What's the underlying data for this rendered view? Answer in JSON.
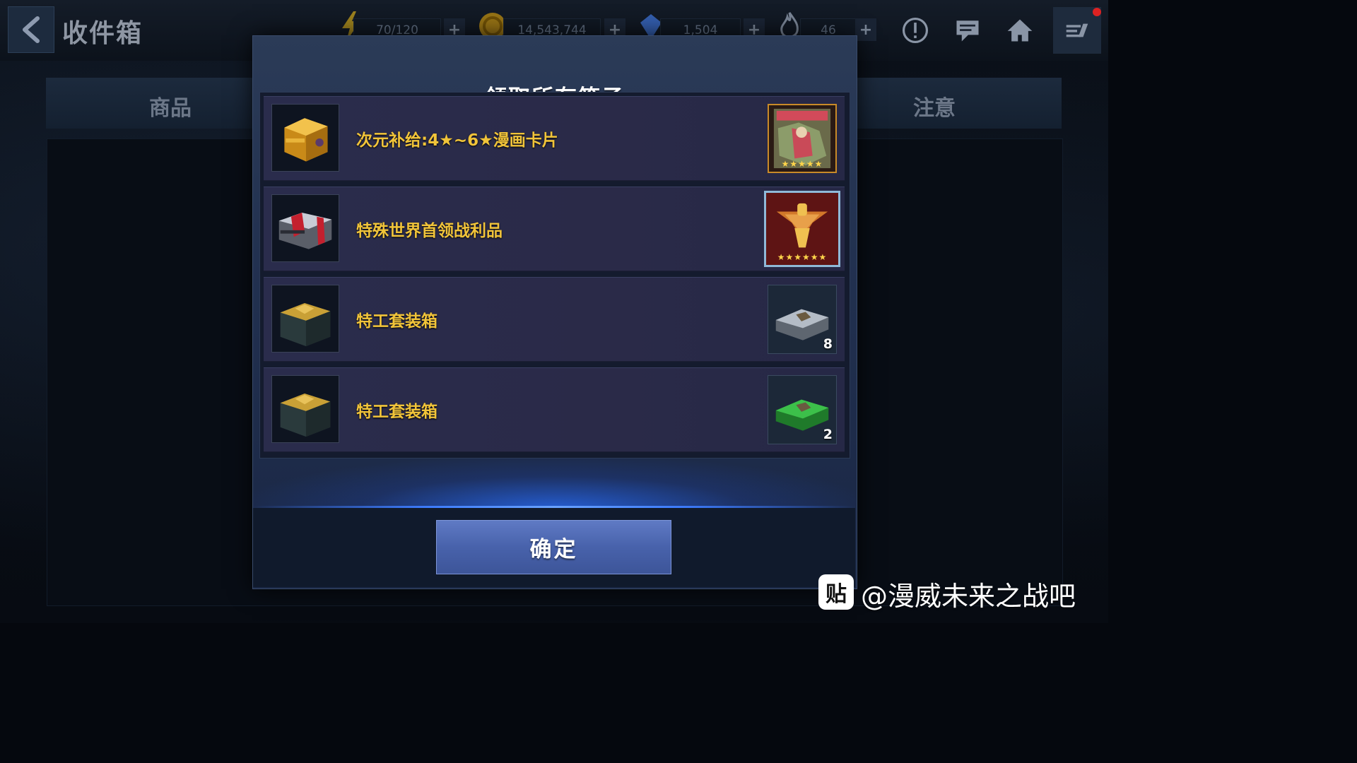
{
  "header": {
    "title": "收件箱",
    "resources": [
      {
        "name": "energy",
        "value": "70/120",
        "icon": "lightning-icon"
      },
      {
        "name": "gold",
        "value": "14,543,744",
        "icon": "gold-coin-icon"
      },
      {
        "name": "crystal",
        "value": "1,504",
        "icon": "crystal-icon"
      },
      {
        "name": "stamina",
        "value": "46",
        "icon": "flame-icon"
      }
    ],
    "add_label": "+"
  },
  "tabs": [
    {
      "label": "商品"
    },
    {
      "label": "注意"
    }
  ],
  "dialog": {
    "title": "领取所有箱子",
    "items": [
      {
        "label": "次元补给:4★~6★漫画卡片",
        "reward": "comic-card",
        "count": "",
        "stars": "★★★★★"
      },
      {
        "label": "特殊世界首领战利品",
        "reward": "boss-emblem",
        "count": "",
        "stars": "★★★★★★"
      },
      {
        "label": "特工套装箱",
        "reward": "silver-gear-box",
        "count": "8",
        "stars": ""
      },
      {
        "label": "特工套装箱",
        "reward": "green-gear-box",
        "count": "2",
        "stars": ""
      }
    ],
    "confirm_label": "确定"
  },
  "watermark": {
    "badge": "贴",
    "text": "@漫威未来之战吧"
  },
  "colors": {
    "item_label": "#f1c43a",
    "confirm_button": "#4862ab",
    "glow": "#3e7dff"
  }
}
